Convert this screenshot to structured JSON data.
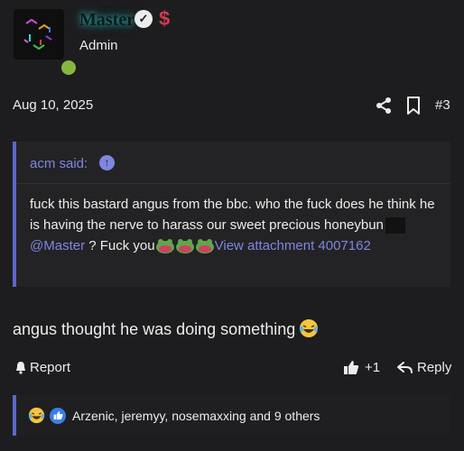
{
  "author": {
    "username": "Master",
    "role": "Admin",
    "verified_glyph": "✓",
    "dollar_glyph": "$",
    "online_color": "#87b63e"
  },
  "post": {
    "date": "Aug 10, 2025",
    "number": "#3",
    "text": "angus thought he was doing something",
    "emoji": "laughing-crying-icon"
  },
  "quote": {
    "author_label": "acm said:",
    "up_glyph": "↑",
    "body_before": "fuck this bastard angus from the bbc. who the fuck does he think he is having the nerve to harass our sweet precious honeybun",
    "mention": "@Master",
    "body_after": " ? Fuck you",
    "attachment_link": "View attachment 4007162"
  },
  "actions": {
    "report": "Report",
    "like_count": "+1",
    "reply": "Reply"
  },
  "reactions": {
    "summary": "Arzenic, jeremyy, nosemaxxing and 9 others",
    "icons": [
      "laughing-crying-icon",
      "thumbs-up-icon"
    ]
  },
  "colors": {
    "accent": "#5c66c8",
    "link": "#7e86e0",
    "background": "#1d1d1f"
  }
}
